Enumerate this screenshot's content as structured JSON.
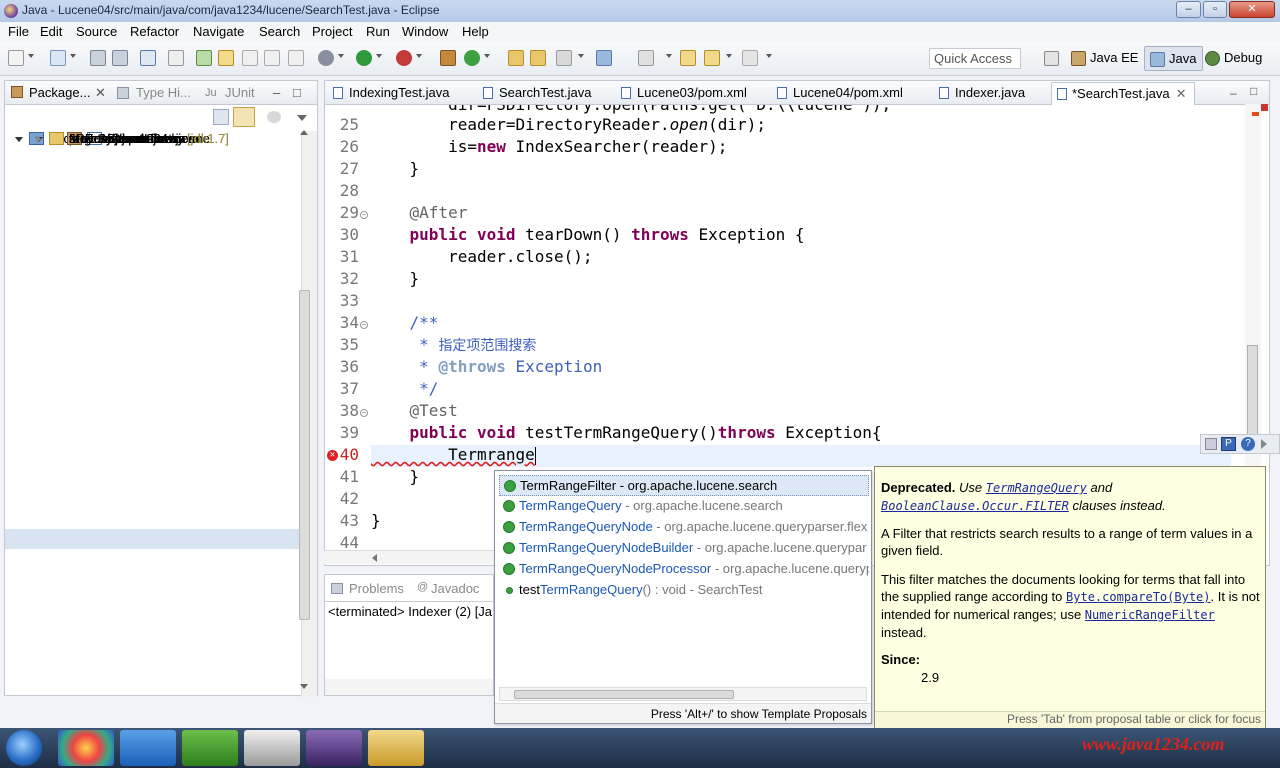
{
  "window": {
    "title": "Java - Lucene04/src/main/java/com/java1234/lucene/SearchTest.java - Eclipse"
  },
  "menu": [
    "File",
    "Edit",
    "Source",
    "Refactor",
    "Navigate",
    "Search",
    "Project",
    "Run",
    "Window",
    "Help"
  ],
  "toolbar": {
    "quick_access_placeholder": "Quick Access",
    "perspectives": [
      "Java EE",
      "Java",
      "Debug"
    ]
  },
  "left_panel": {
    "tabs": [
      "Package...",
      "Type Hi...",
      "JUnit"
    ],
    "tree": [
      {
        "label": "src",
        "indent": 1,
        "icon": "folder",
        "twisty": "closed"
      },
      {
        "label": "target",
        "indent": 1,
        "icon": "folder",
        "twisty": ""
      },
      {
        "label": "pom.xml",
        "indent": 1,
        "icon": "xml",
        "twisty": ""
      },
      {
        "label": "Lucene03",
        "indent": 0,
        "icon": "proj",
        "twisty": "open"
      },
      {
        "label": "src/main/java",
        "indent": 1,
        "icon": "srcfolder",
        "twisty": "open"
      },
      {
        "label": "com.java1234.lucene",
        "indent": 2,
        "icon": "pkg",
        "twisty": "open"
      },
      {
        "label": "Indexer.java",
        "indent": 3,
        "icon": "java",
        "twisty": "closed"
      },
      {
        "label": "SearchTest.java",
        "indent": 3,
        "icon": "java",
        "twisty": "closed"
      },
      {
        "label": "src/main/resources",
        "indent": 1,
        "icon": "srcfolder",
        "twisty": ""
      },
      {
        "label": "src/test/java",
        "indent": 1,
        "icon": "srcfolder",
        "twisty": ""
      },
      {
        "label": "src/test/resources",
        "indent": 1,
        "icon": "srcfolder",
        "twisty": ""
      },
      {
        "label": "Maven Dependencies",
        "indent": 1,
        "icon": "lib",
        "twisty": "closed"
      },
      {
        "label": "JRE System Library",
        "suffix": "[jdk1.7]",
        "indent": 1,
        "icon": "lib",
        "twisty": "closed"
      },
      {
        "label": "src",
        "indent": 1,
        "icon": "folder",
        "twisty": "closed"
      },
      {
        "label": "target",
        "indent": 1,
        "icon": "folder",
        "twisty": ""
      },
      {
        "label": "pom.xml",
        "indent": 1,
        "icon": "xml",
        "twisty": ""
      },
      {
        "label": "Lucene04",
        "indent": 0,
        "icon": "proj",
        "twisty": "open"
      },
      {
        "label": "src/main/java",
        "indent": 1,
        "icon": "srcfolder",
        "twisty": "open"
      },
      {
        "label": "com.java1234.lucene",
        "indent": 2,
        "icon": "pkg",
        "twisty": "open"
      },
      {
        "label": "Indexer.java",
        "indent": 3,
        "icon": "java",
        "twisty": "closed"
      },
      {
        "label": "SearchTest.java",
        "indent": 3,
        "icon": "java",
        "twisty": "closed",
        "selected": true
      },
      {
        "label": "src/main/resources",
        "indent": 1,
        "icon": "srcfolder",
        "twisty": ""
      },
      {
        "label": "src/test/java",
        "indent": 1,
        "icon": "srcfolder",
        "twisty": ""
      },
      {
        "label": "src/test/resources",
        "indent": 1,
        "icon": "srcfolder",
        "twisty": ""
      },
      {
        "label": "Maven Dependencies",
        "indent": 1,
        "icon": "lib",
        "twisty": "closed"
      },
      {
        "label": "JRE System Library",
        "suffix": "[jdk1.7]",
        "indent": 1,
        "icon": "lib",
        "twisty": "closed"
      },
      {
        "label": "src",
        "indent": 1,
        "icon": "folder",
        "twisty": "closed"
      },
      {
        "label": "target",
        "indent": 1,
        "icon": "folder",
        "twisty": ""
      }
    ]
  },
  "editor": {
    "tabs": [
      "IndexingTest.java",
      "SearchTest.java",
      "Lucene03/pom.xml",
      "Lucene04/pom.xml",
      "Indexer.java",
      "*SearchTest.java"
    ],
    "active_tab": 5,
    "lines": [
      {
        "n": "25",
        "tokens": [
          [
            "",
            "        reader=DirectoryReader."
          ],
          [
            "it",
            "open"
          ],
          [
            "",
            "(dir);"
          ]
        ]
      },
      {
        "n": "26",
        "tokens": [
          [
            "",
            "        is="
          ],
          [
            "kw",
            "new"
          ],
          [
            "",
            " IndexSearcher(reader);"
          ]
        ]
      },
      {
        "n": "27",
        "tokens": [
          [
            "",
            "    }"
          ]
        ]
      },
      {
        "n": "28",
        "tokens": []
      },
      {
        "n": "29",
        "fold": true,
        "tokens": [
          [
            "ann",
            "    @After"
          ]
        ]
      },
      {
        "n": "30",
        "tokens": [
          [
            "kw",
            "    public"
          ],
          [
            "",
            " "
          ],
          [
            "kw",
            "void"
          ],
          [
            "",
            " tearDown() "
          ],
          [
            "kw",
            "throws"
          ],
          [
            "",
            " Exception {"
          ]
        ]
      },
      {
        "n": "31",
        "tokens": [
          [
            "",
            "        reader.close();"
          ]
        ]
      },
      {
        "n": "32",
        "tokens": [
          [
            "",
            "    }"
          ]
        ]
      },
      {
        "n": "33",
        "tokens": []
      },
      {
        "n": "34",
        "fold": true,
        "tokens": [
          [
            "cm",
            "    /**"
          ]
        ]
      },
      {
        "n": "35",
        "tokens": [
          [
            "cm",
            "     * "
          ],
          [
            "cn",
            "指定项范围搜索"
          ]
        ]
      },
      {
        "n": "36",
        "tokens": [
          [
            "cm",
            "     * "
          ],
          [
            "cmb",
            "@throws"
          ],
          [
            "cm",
            " Exception"
          ]
        ]
      },
      {
        "n": "37",
        "tokens": [
          [
            "cm",
            "     */"
          ]
        ]
      },
      {
        "n": "38",
        "fold": true,
        "tokens": [
          [
            "ann",
            "    @Test"
          ]
        ]
      },
      {
        "n": "39",
        "tokens": [
          [
            "kw",
            "    public"
          ],
          [
            "",
            " "
          ],
          [
            "kw",
            "void"
          ],
          [
            "",
            " testTermRangeQuery()"
          ],
          [
            "kw",
            "throws"
          ],
          [
            "",
            " Exception{"
          ]
        ]
      },
      {
        "n": "40",
        "error": true,
        "tokens": [
          [
            "",
            "        Termrange"
          ]
        ]
      },
      {
        "n": "41",
        "tokens": [
          [
            "",
            "    }"
          ]
        ]
      },
      {
        "n": "42",
        "tokens": []
      },
      {
        "n": "43",
        "tokens": [
          [
            "",
            "}"
          ]
        ]
      },
      {
        "n": "44",
        "tokens": []
      }
    ]
  },
  "bottom_panel": {
    "tabs": [
      "Problems",
      "Javadoc"
    ],
    "console_text": "<terminated> Indexer (2) [Ja"
  },
  "proposals": {
    "items": [
      {
        "highlight": "TermRangeFilter",
        "rest": " - org.apache.lucene.search",
        "selected": true,
        "icon": "class"
      },
      {
        "highlight": "TermRangeQuery",
        "rest": " - org.apache.lucene.search",
        "icon": "class"
      },
      {
        "highlight": "TermRangeQueryNode",
        "rest": " - org.apache.lucene.queryparser.flex",
        "icon": "class"
      },
      {
        "highlight": "TermRangeQueryNodeBuilder",
        "rest": " - org.apache.lucene.querypar",
        "icon": "class"
      },
      {
        "highlight": "TermRangeQueryNodeProcessor",
        "rest": " - org.apache.lucene.queryp",
        "icon": "class"
      },
      {
        "prefix": "test",
        "highlight": "TermRangeQuery",
        "rest": "() : void - SearchTest",
        "icon": "method"
      }
    ],
    "hint": "Press 'Alt+/' to show Template Proposals"
  },
  "doc": {
    "deprecated_label": "Deprecated.",
    "deprecated_1": " Use ",
    "link_1": "TermRangeQuery",
    "deprecated_2": " and",
    "link_2": "BooleanClause.Occur.FILTER",
    "deprecated_3": " clauses instead.",
    "para_1": "A Filter that restricts search results to a range of term values in a given field.",
    "para_2a": "This filter matches the documents looking for terms that fall into the supplied range according to ",
    "link_3": "Byte.compareTo(Byte)",
    "para_2b": ". It is not intended for numerical ranges; use ",
    "link_4": "NumericRangeFilter",
    "para_2c": " instead.",
    "since_label": "Since:",
    "since_value": "2.9",
    "footer": "Press 'Tab' from proposal table or click for focus"
  },
  "watermark": "www.java1234.com",
  "colors": {
    "keyword": "#7f0055",
    "annotation": "#646464",
    "javadoc": "#3f5fbf",
    "link": "#1a2a9c",
    "doc_bg": "#ffffe1"
  }
}
